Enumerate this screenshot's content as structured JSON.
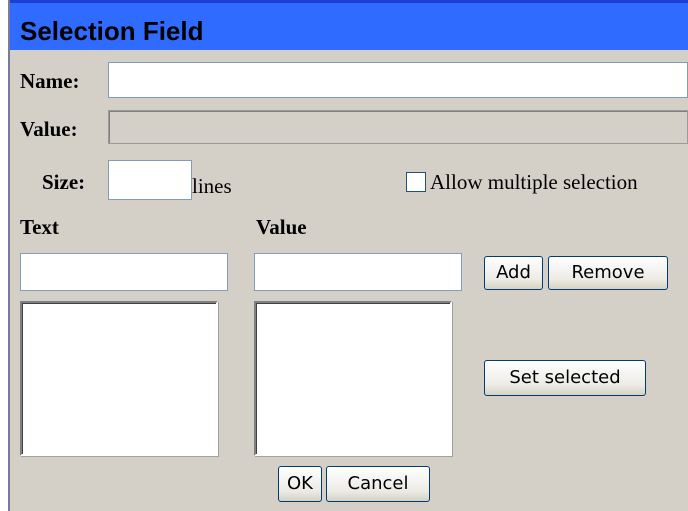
{
  "dialog": {
    "title": "Selection Field"
  },
  "form": {
    "name_label": "Name:",
    "name_value": "",
    "value_label": "Value:",
    "value_value": "",
    "size_label": "Size:",
    "size_value": "",
    "lines_label": "lines",
    "multiple_label": "Allow multiple selection",
    "multiple_checked": false
  },
  "options": {
    "text_header": "Text",
    "value_header": "Value",
    "text_input": "",
    "value_input": "",
    "text_list": [],
    "value_list": [],
    "add_label": "Add",
    "remove_label": "Remove",
    "set_selected_label": "Set selected"
  },
  "footer": {
    "ok_label": "OK",
    "cancel_label": "Cancel"
  }
}
